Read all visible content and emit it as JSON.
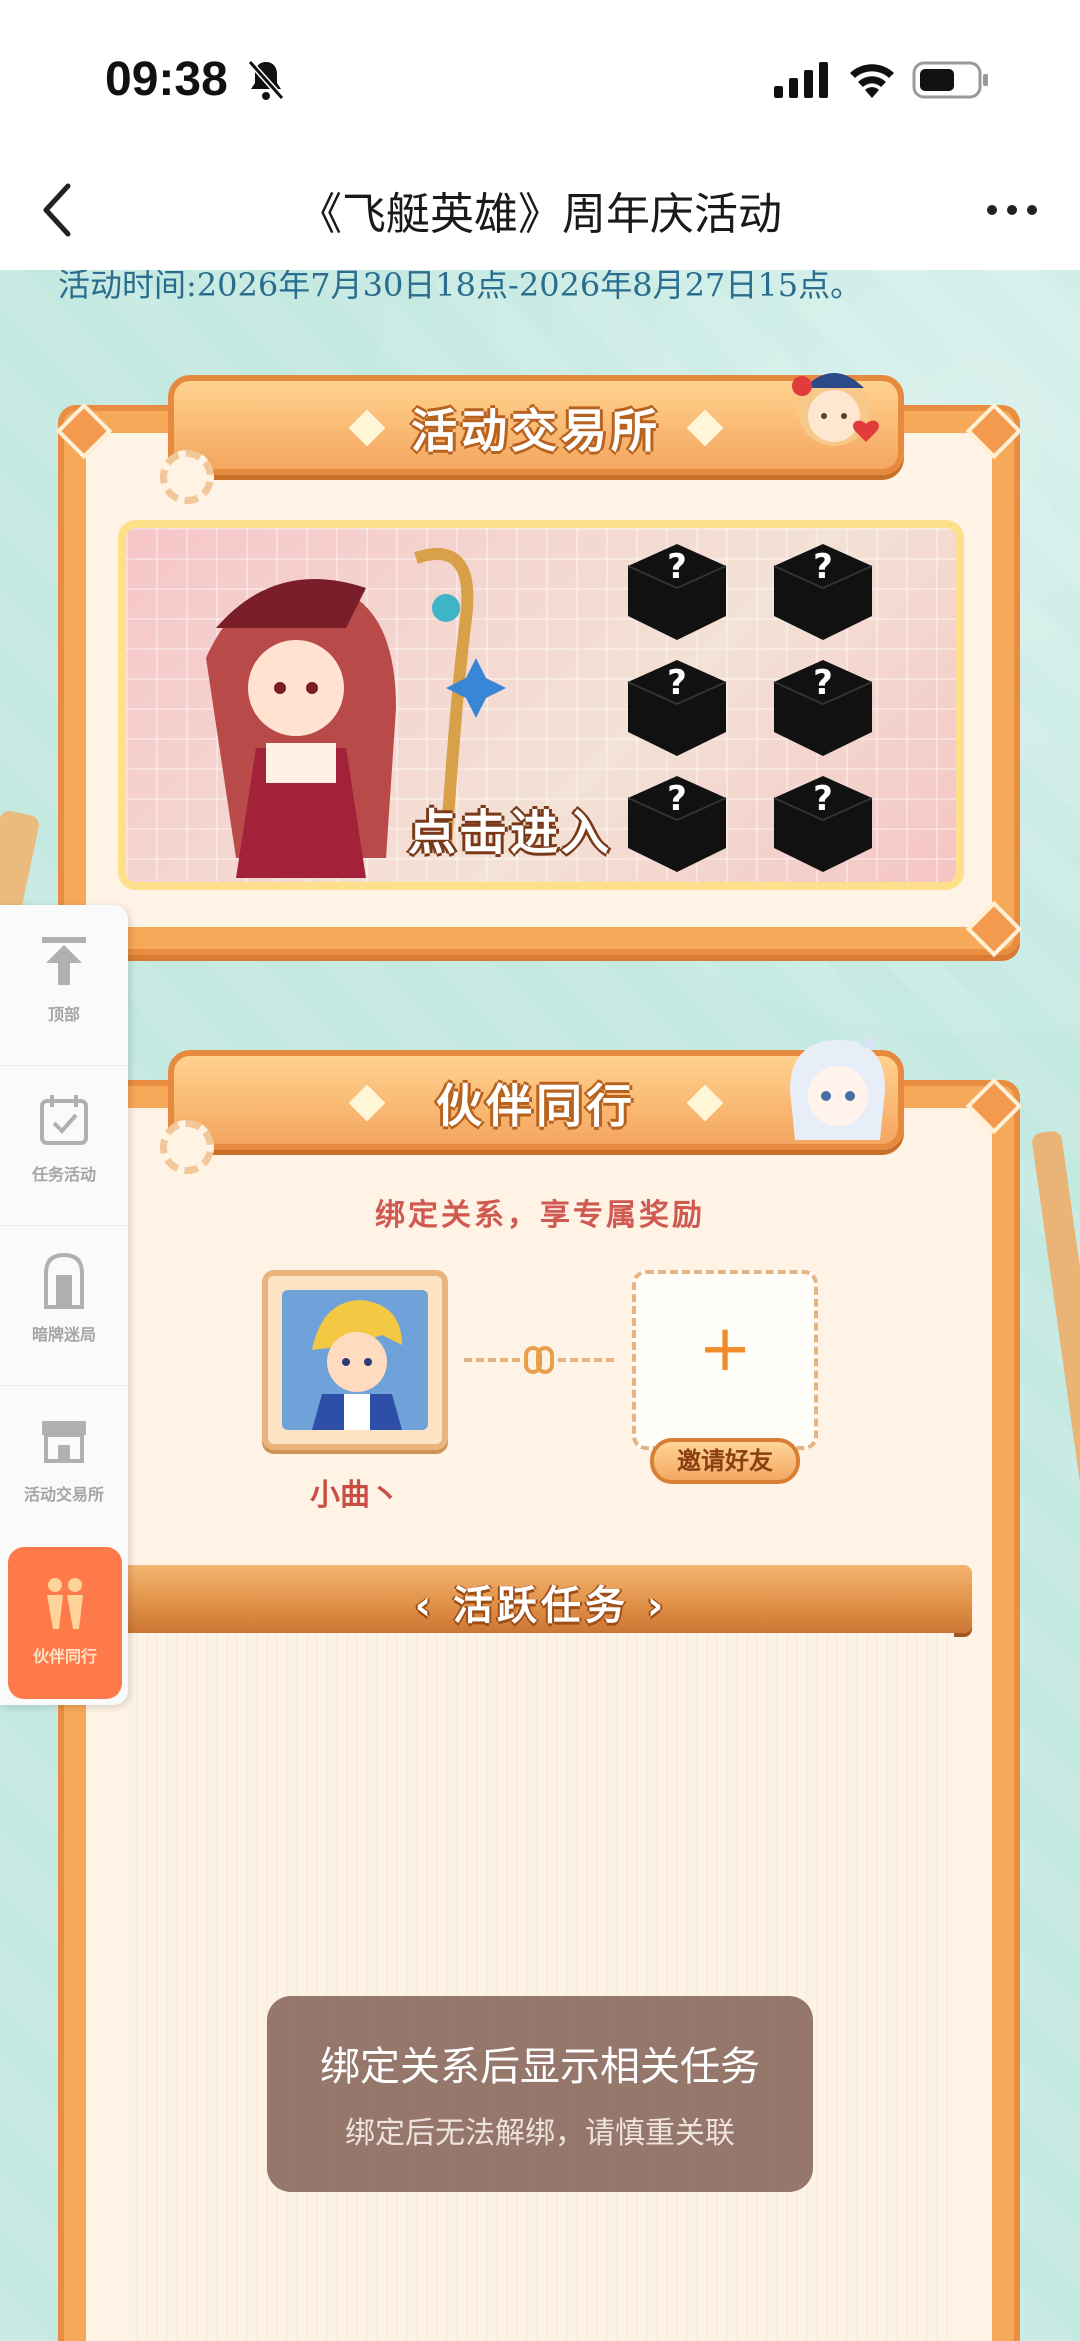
{
  "status_bar": {
    "time": "09:38",
    "icons": [
      "bell-muted-icon",
      "signal-icon",
      "wifi-icon",
      "battery-icon"
    ]
  },
  "nav": {
    "title": "《飞艇英雄》周年庆活动",
    "back_icon": "chevron-left-icon",
    "more_icon": "more-dots-icon"
  },
  "page": {
    "activity_time": "活动时间:2026年7月30日18点-2026年8月27日15点。"
  },
  "exchange": {
    "title": "活动交易所",
    "enter_label": "点击进入"
  },
  "partner": {
    "title": "伙伴同行",
    "subtitle": "绑定关系，享专属奖励",
    "player_name": "小曲丶",
    "invite_button": "邀请好友",
    "task_title": "活跃任务"
  },
  "toast": {
    "title": "绑定关系后显示相关任务",
    "subtitle": "绑定后无法解绑，请慎重关联"
  },
  "side_nav": {
    "items": [
      {
        "label": "顶部",
        "icon": "arrow-top-icon"
      },
      {
        "label": "任务活动",
        "icon": "calendar-check-icon"
      },
      {
        "label": "暗牌迷局",
        "icon": "door-icon"
      },
      {
        "label": "活动交易所",
        "icon": "shop-icon"
      },
      {
        "label": "伙伴同行",
        "icon": "partners-icon"
      }
    ],
    "active_index": 4
  },
  "colors": {
    "accent_orange": "#f7a95a",
    "toast_bg": "#8f7064",
    "subtitle_red": "#d05a52",
    "background_teal": "#c3e9e1"
  }
}
